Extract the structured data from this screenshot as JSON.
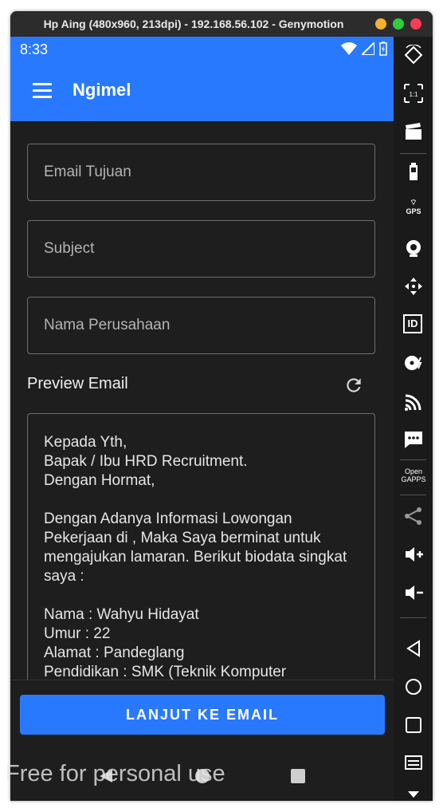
{
  "window": {
    "title": "Hp Aing (480x960, 213dpi) - 192.168.56.102 - Genymotion",
    "controls": [
      "#f6b12b",
      "#2ecc40",
      "#ff3b57"
    ]
  },
  "statusbar": {
    "time": "8:33"
  },
  "appbar": {
    "title": "Ngimel",
    "color": "#2979ff"
  },
  "form": {
    "email_placeholder": "Email Tujuan",
    "subject_placeholder": "Subject",
    "company_placeholder": "Nama Perusahaan"
  },
  "preview": {
    "label": "Preview Email",
    "body": "Kepada Yth,\nBapak / Ibu HRD Recruitment.\nDengan Hormat,\n\nDengan Adanya Informasi Lowongan Pekerjaan di , Maka Saya berminat untuk mengajukan lamaran. Berikut biodata singkat saya :\n\nNama : Wahyu Hidayat\nUmur : 22\nAlamat : Pandeglang\nPendidikan : SMK (Teknik Komputer"
  },
  "action": {
    "label": "LANJUT KE EMAIL"
  },
  "sidebar": {
    "gps_label": "GPS",
    "id_label": "ID",
    "opengapps_label": "Open\nGAPPS"
  },
  "watermark": "Free for personal use"
}
